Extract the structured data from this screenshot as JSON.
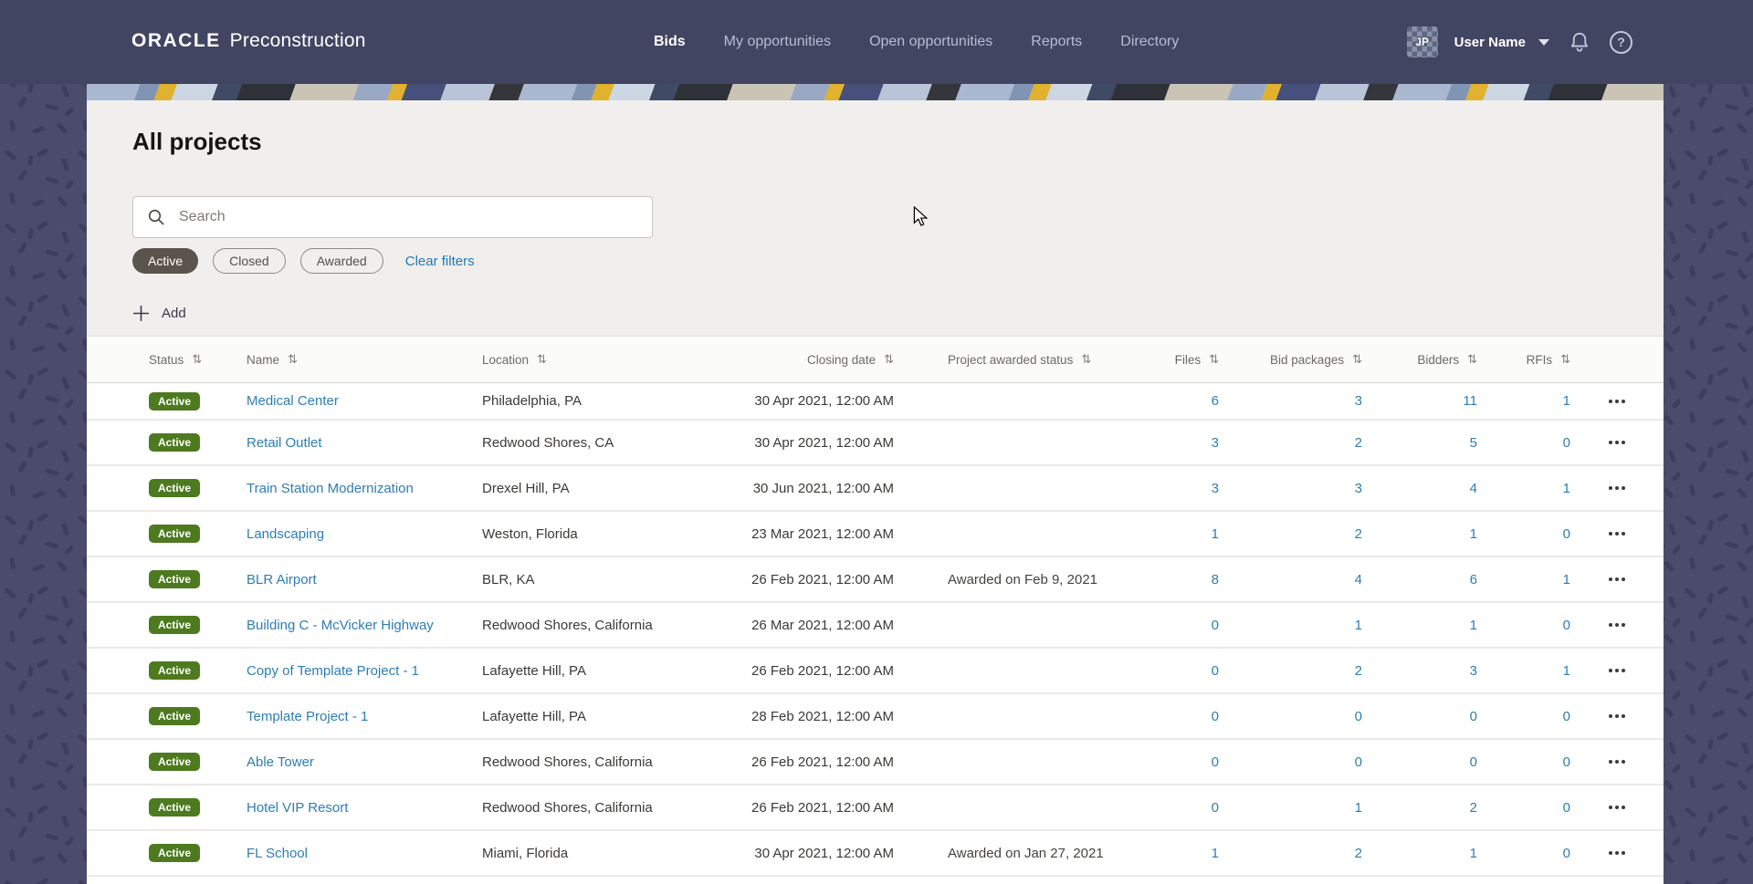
{
  "brand": {
    "logo": "ORACLE",
    "product": "Preconstruction"
  },
  "nav": [
    {
      "label": "Bids",
      "active": true
    },
    {
      "label": "My opportunities",
      "active": false
    },
    {
      "label": "Open opportunities",
      "active": false
    },
    {
      "label": "Reports",
      "active": false
    },
    {
      "label": "Directory",
      "active": false
    }
  ],
  "user": {
    "initials": "JP",
    "name": "User Name"
  },
  "page": {
    "title": "All projects",
    "search_placeholder": "Search",
    "clear_filters_label": "Clear filters",
    "add_label": "Add"
  },
  "filters": [
    {
      "label": "Active",
      "selected": true
    },
    {
      "label": "Closed",
      "selected": false
    },
    {
      "label": "Awarded",
      "selected": false
    }
  ],
  "table": {
    "columns": [
      "Status",
      "Name",
      "Location",
      "Closing date",
      "Project awarded status",
      "Files",
      "Bid packages",
      "Bidders",
      "RFIs"
    ],
    "rows": [
      {
        "status": "Active",
        "name": "Medical Center",
        "location": "Philadelphia, PA",
        "closing": "30 Apr 2021, 12:00 AM",
        "awarded": "",
        "files": "6",
        "bid_packages": "3",
        "bidders": "11",
        "rfis": "1"
      },
      {
        "status": "Active",
        "name": "Retail Outlet",
        "location": "Redwood Shores, CA",
        "closing": "30 Apr 2021, 12:00 AM",
        "awarded": "",
        "files": "3",
        "bid_packages": "2",
        "bidders": "5",
        "rfis": "0"
      },
      {
        "status": "Active",
        "name": "Train Station Modernization",
        "location": "Drexel Hill, PA",
        "closing": "30 Jun 2021, 12:00 AM",
        "awarded": "",
        "files": "3",
        "bid_packages": "3",
        "bidders": "4",
        "rfis": "1"
      },
      {
        "status": "Active",
        "name": "Landscaping",
        "location": "Weston, Florida",
        "closing": "23 Mar 2021, 12:00 AM",
        "awarded": "",
        "files": "1",
        "bid_packages": "2",
        "bidders": "1",
        "rfis": "0"
      },
      {
        "status": "Active",
        "name": "BLR Airport",
        "location": "BLR, KA",
        "closing": "26 Feb 2021, 12:00 AM",
        "awarded": "Awarded on Feb 9, 2021",
        "files": "8",
        "bid_packages": "4",
        "bidders": "6",
        "rfis": "1"
      },
      {
        "status": "Active",
        "name": "Building C - McVicker Highway",
        "location": "Redwood Shores, California",
        "closing": "26 Mar 2021, 12:00 AM",
        "awarded": "",
        "files": "0",
        "bid_packages": "1",
        "bidders": "1",
        "rfis": "0"
      },
      {
        "status": "Active",
        "name": "Copy of Template Project - 1",
        "location": "Lafayette Hill, PA",
        "closing": "26 Feb 2021, 12:00 AM",
        "awarded": "",
        "files": "0",
        "bid_packages": "2",
        "bidders": "3",
        "rfis": "1"
      },
      {
        "status": "Active",
        "name": "Template Project - 1",
        "location": "Lafayette Hill, PA",
        "closing": "28 Feb 2021, 12:00 AM",
        "awarded": "",
        "files": "0",
        "bid_packages": "0",
        "bidders": "0",
        "rfis": "0"
      },
      {
        "status": "Active",
        "name": "Able Tower",
        "location": "Redwood Shores, California",
        "closing": "26 Feb 2021, 12:00 AM",
        "awarded": "",
        "files": "0",
        "bid_packages": "0",
        "bidders": "0",
        "rfis": "0"
      },
      {
        "status": "Active",
        "name": "Hotel VIP Resort",
        "location": "Redwood Shores, California",
        "closing": "26 Feb 2021, 12:00 AM",
        "awarded": "",
        "files": "0",
        "bid_packages": "1",
        "bidders": "2",
        "rfis": "0"
      },
      {
        "status": "Active",
        "name": "FL School",
        "location": "Miami, Florida",
        "closing": "30 Apr 2021, 12:00 AM",
        "awarded": "Awarded on Jan 27, 2021",
        "files": "1",
        "bid_packages": "2",
        "bidders": "1",
        "rfis": "0"
      }
    ],
    "sort_glyph": "⇅"
  },
  "colors": {
    "header_bg": "#414562",
    "page_bg": "#4b4b6b",
    "panel_bg": "#f1efed",
    "link_blue": "#2d7db3",
    "badge_green": "#4e7a1f",
    "chip_selected_bg": "#5b544d",
    "accent_yellow": "#e0b22f"
  }
}
